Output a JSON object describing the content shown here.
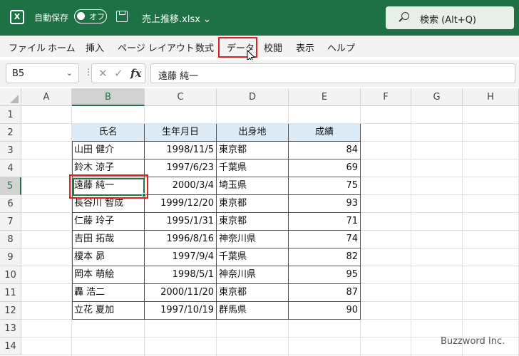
{
  "titlebar": {
    "logo": "X",
    "autosave_label": "自動保存",
    "autosave_state": "オフ",
    "filename": "売上推移.xlsx",
    "search_text": "検索 (Alt+Q)"
  },
  "ribbon": {
    "tabs": [
      "ファイル",
      "ホーム",
      "挿入",
      "ページ レイアウト",
      "数式",
      "データ",
      "校閲",
      "表示",
      "ヘルプ"
    ],
    "highlighted_tab": "データ"
  },
  "formula_bar": {
    "name_box": "B5",
    "fx": "fx",
    "value": "遠藤 純一"
  },
  "grid": {
    "columns": [
      "A",
      "B",
      "C",
      "D",
      "E",
      "F",
      "G",
      "H"
    ],
    "rows": [
      "1",
      "2",
      "3",
      "4",
      "5",
      "6",
      "7",
      "8",
      "9",
      "10",
      "11",
      "12",
      "13",
      "14"
    ],
    "active_column": "B",
    "active_row": "5"
  },
  "table": {
    "headers": [
      "氏名",
      "生年月日",
      "出身地",
      "成績"
    ],
    "rows": [
      [
        "山田 健介",
        "1998/11/5",
        "東京都",
        "84"
      ],
      [
        "鈴木 涼子",
        "1997/6/23",
        "千葉県",
        "69"
      ],
      [
        "遠藤 純一",
        "2000/3/4",
        "埼玉県",
        "75"
      ],
      [
        "長谷川 智成",
        "1999/12/20",
        "東京都",
        "93"
      ],
      [
        "仁藤 玲子",
        "1995/1/31",
        "東京都",
        "71"
      ],
      [
        "吉田 拓哉",
        "1996/8/16",
        "神奈川県",
        "74"
      ],
      [
        "榎本 昴",
        "1997/9/4",
        "千葉県",
        "82"
      ],
      [
        "岡本 萌絵",
        "1998/5/1",
        "神奈川県",
        "95"
      ],
      [
        "轟 浩二",
        "2000/11/20",
        "東京都",
        "87"
      ],
      [
        "立花 夏加",
        "1997/10/19",
        "群馬県",
        "90"
      ]
    ]
  },
  "watermark": "Buzzword Inc.",
  "colors": {
    "titlebar": "#1e7145",
    "header_fill": "#ddebf7",
    "highlight": "#e02020",
    "selection": "#217346"
  }
}
